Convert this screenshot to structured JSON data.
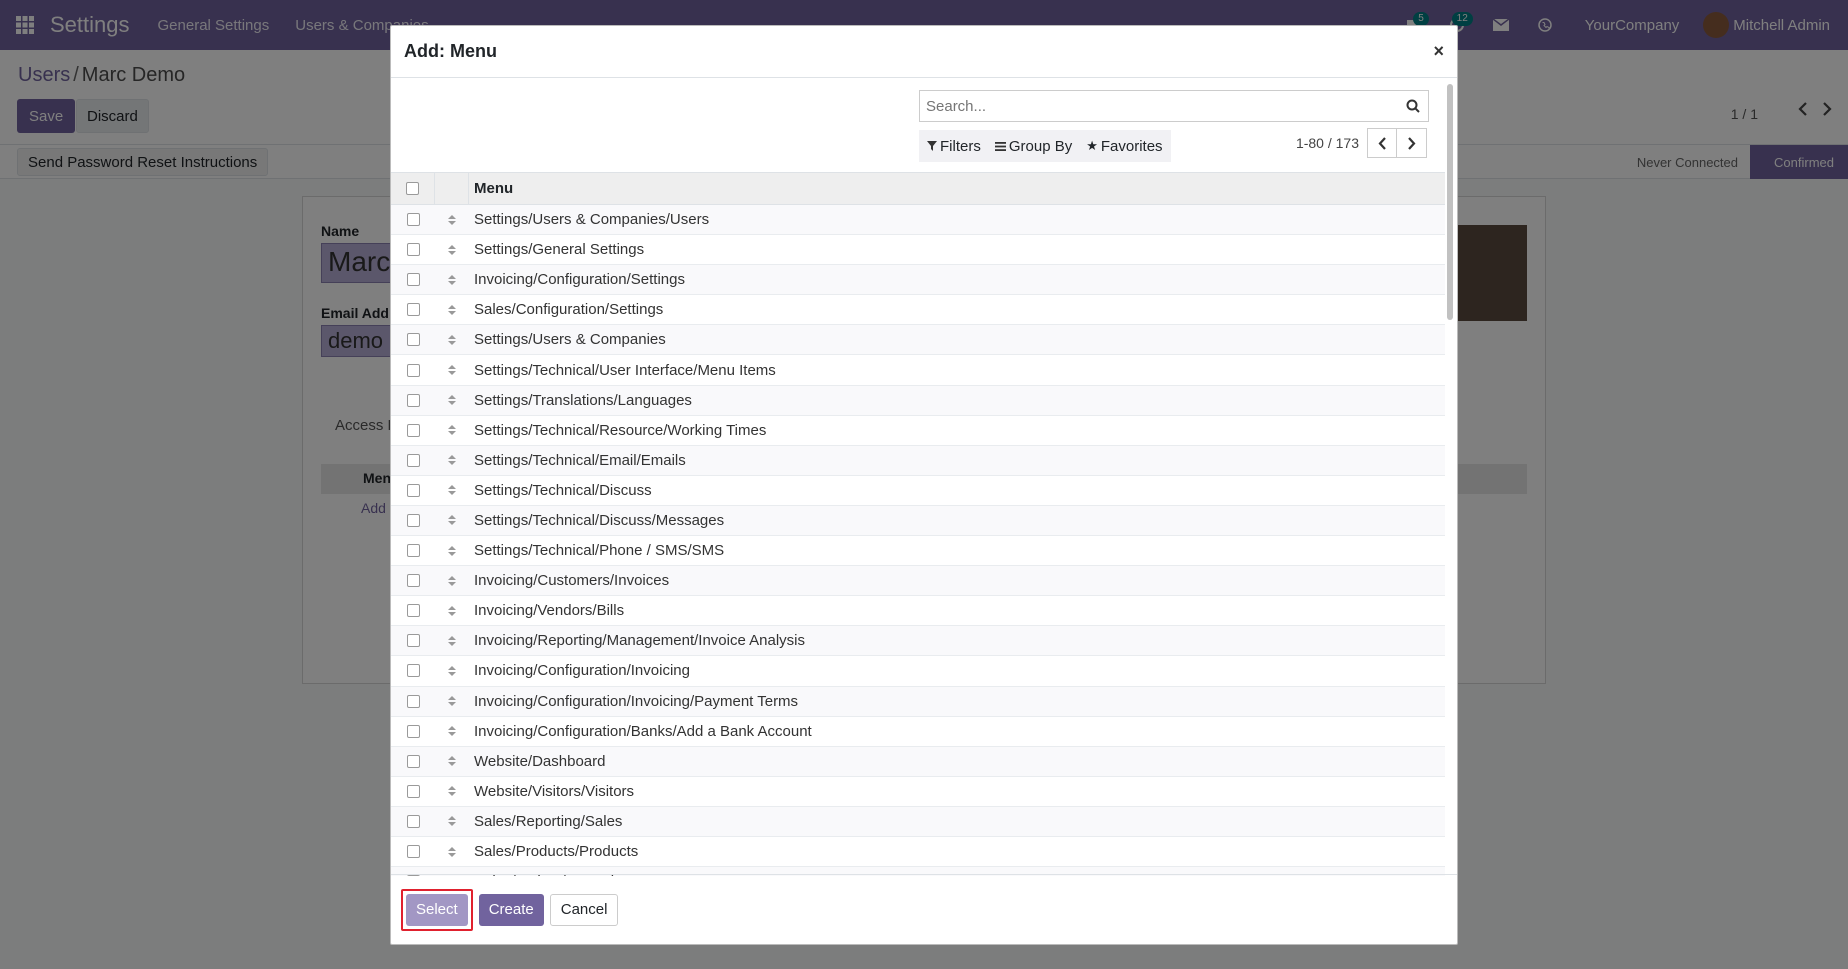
{
  "navbar": {
    "brand": "Settings",
    "menus": [
      "General Settings",
      "Users & Companies"
    ],
    "chat_badge": "5",
    "activity_badge": "12",
    "company": "YourCompany",
    "user": "Mitchell Admin"
  },
  "control_panel": {
    "breadcrumb_parent": "Users",
    "breadcrumb_sep": "/",
    "breadcrumb_current": "Marc Demo",
    "save_label": "Save",
    "discard_label": "Discard",
    "pager": "1 / 1"
  },
  "status": {
    "reset_button": "Send Password Reset Instructions",
    "stage_never": "Never Connected",
    "stage_confirmed": "Confirmed"
  },
  "sheet": {
    "name_label": "Name",
    "name_value": "Marc",
    "email_label": "Email Add",
    "email_value": "demo",
    "tab_label": "Access R",
    "col_label": "Men",
    "add_label": "Add"
  },
  "modal": {
    "title": "Add: Menu",
    "close": "×",
    "search_placeholder": "Search...",
    "filters_label": "Filters",
    "groupby_label": "Group By",
    "favorites_label": "Favorites",
    "pager": "1-80 / 173",
    "column_header": "Menu",
    "rows": [
      "Settings/Users & Companies/Users",
      "Settings/General Settings",
      "Invoicing/Configuration/Settings",
      "Sales/Configuration/Settings",
      "Settings/Users & Companies",
      "Settings/Technical/User Interface/Menu Items",
      "Settings/Translations/Languages",
      "Settings/Technical/Resource/Working Times",
      "Settings/Technical/Email/Emails",
      "Settings/Technical/Discuss",
      "Settings/Technical/Discuss/Messages",
      "Settings/Technical/Phone / SMS/SMS",
      "Invoicing/Customers/Invoices",
      "Invoicing/Vendors/Bills",
      "Invoicing/Reporting/Management/Invoice Analysis",
      "Invoicing/Configuration/Invoicing",
      "Invoicing/Configuration/Invoicing/Payment Terms",
      "Invoicing/Configuration/Banks/Add a Bank Account",
      "Website/Dashboard",
      "Website/Visitors/Visitors",
      "Sales/Reporting/Sales",
      "Sales/Products/Products",
      "Sales/Orders/Quotations"
    ],
    "select_label": "Select",
    "create_label": "Create",
    "cancel_label": "Cancel"
  },
  "colors": {
    "brand": "#71639e",
    "highlight": "#e0212e"
  }
}
